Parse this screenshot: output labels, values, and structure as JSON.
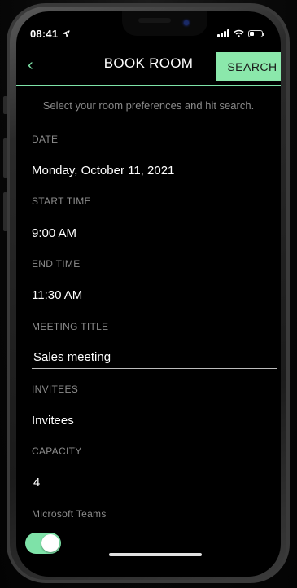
{
  "status": {
    "time": "08:41",
    "location_icon": "location-arrow-icon",
    "signal_icon": "signal-bars-icon",
    "wifi_icon": "wifi-icon",
    "battery_icon": "battery-icon",
    "battery_level": 0.35
  },
  "nav": {
    "back_icon": "‹",
    "title": "BOOK ROOM",
    "search_label": "SEARCH"
  },
  "hint": "Select your room preferences and hit search.",
  "fields": {
    "date": {
      "label": "DATE",
      "value": "Monday, October 11, 2021"
    },
    "start_time": {
      "label": "START TIME",
      "value": "9:00 AM"
    },
    "end_time": {
      "label": "END TIME",
      "value": "11:30 AM"
    },
    "meeting_title": {
      "label": "MEETING TITLE",
      "value": "Sales meeting"
    },
    "invitees": {
      "label": "INVITEES",
      "value": "Invitees"
    },
    "capacity": {
      "label": "CAPACITY",
      "value": "4"
    },
    "teams": {
      "label": "Microsoft Teams",
      "enabled": true
    }
  },
  "colors": {
    "accent": "#7ee2a8",
    "background": "#000000",
    "label": "#8c8c8c"
  }
}
